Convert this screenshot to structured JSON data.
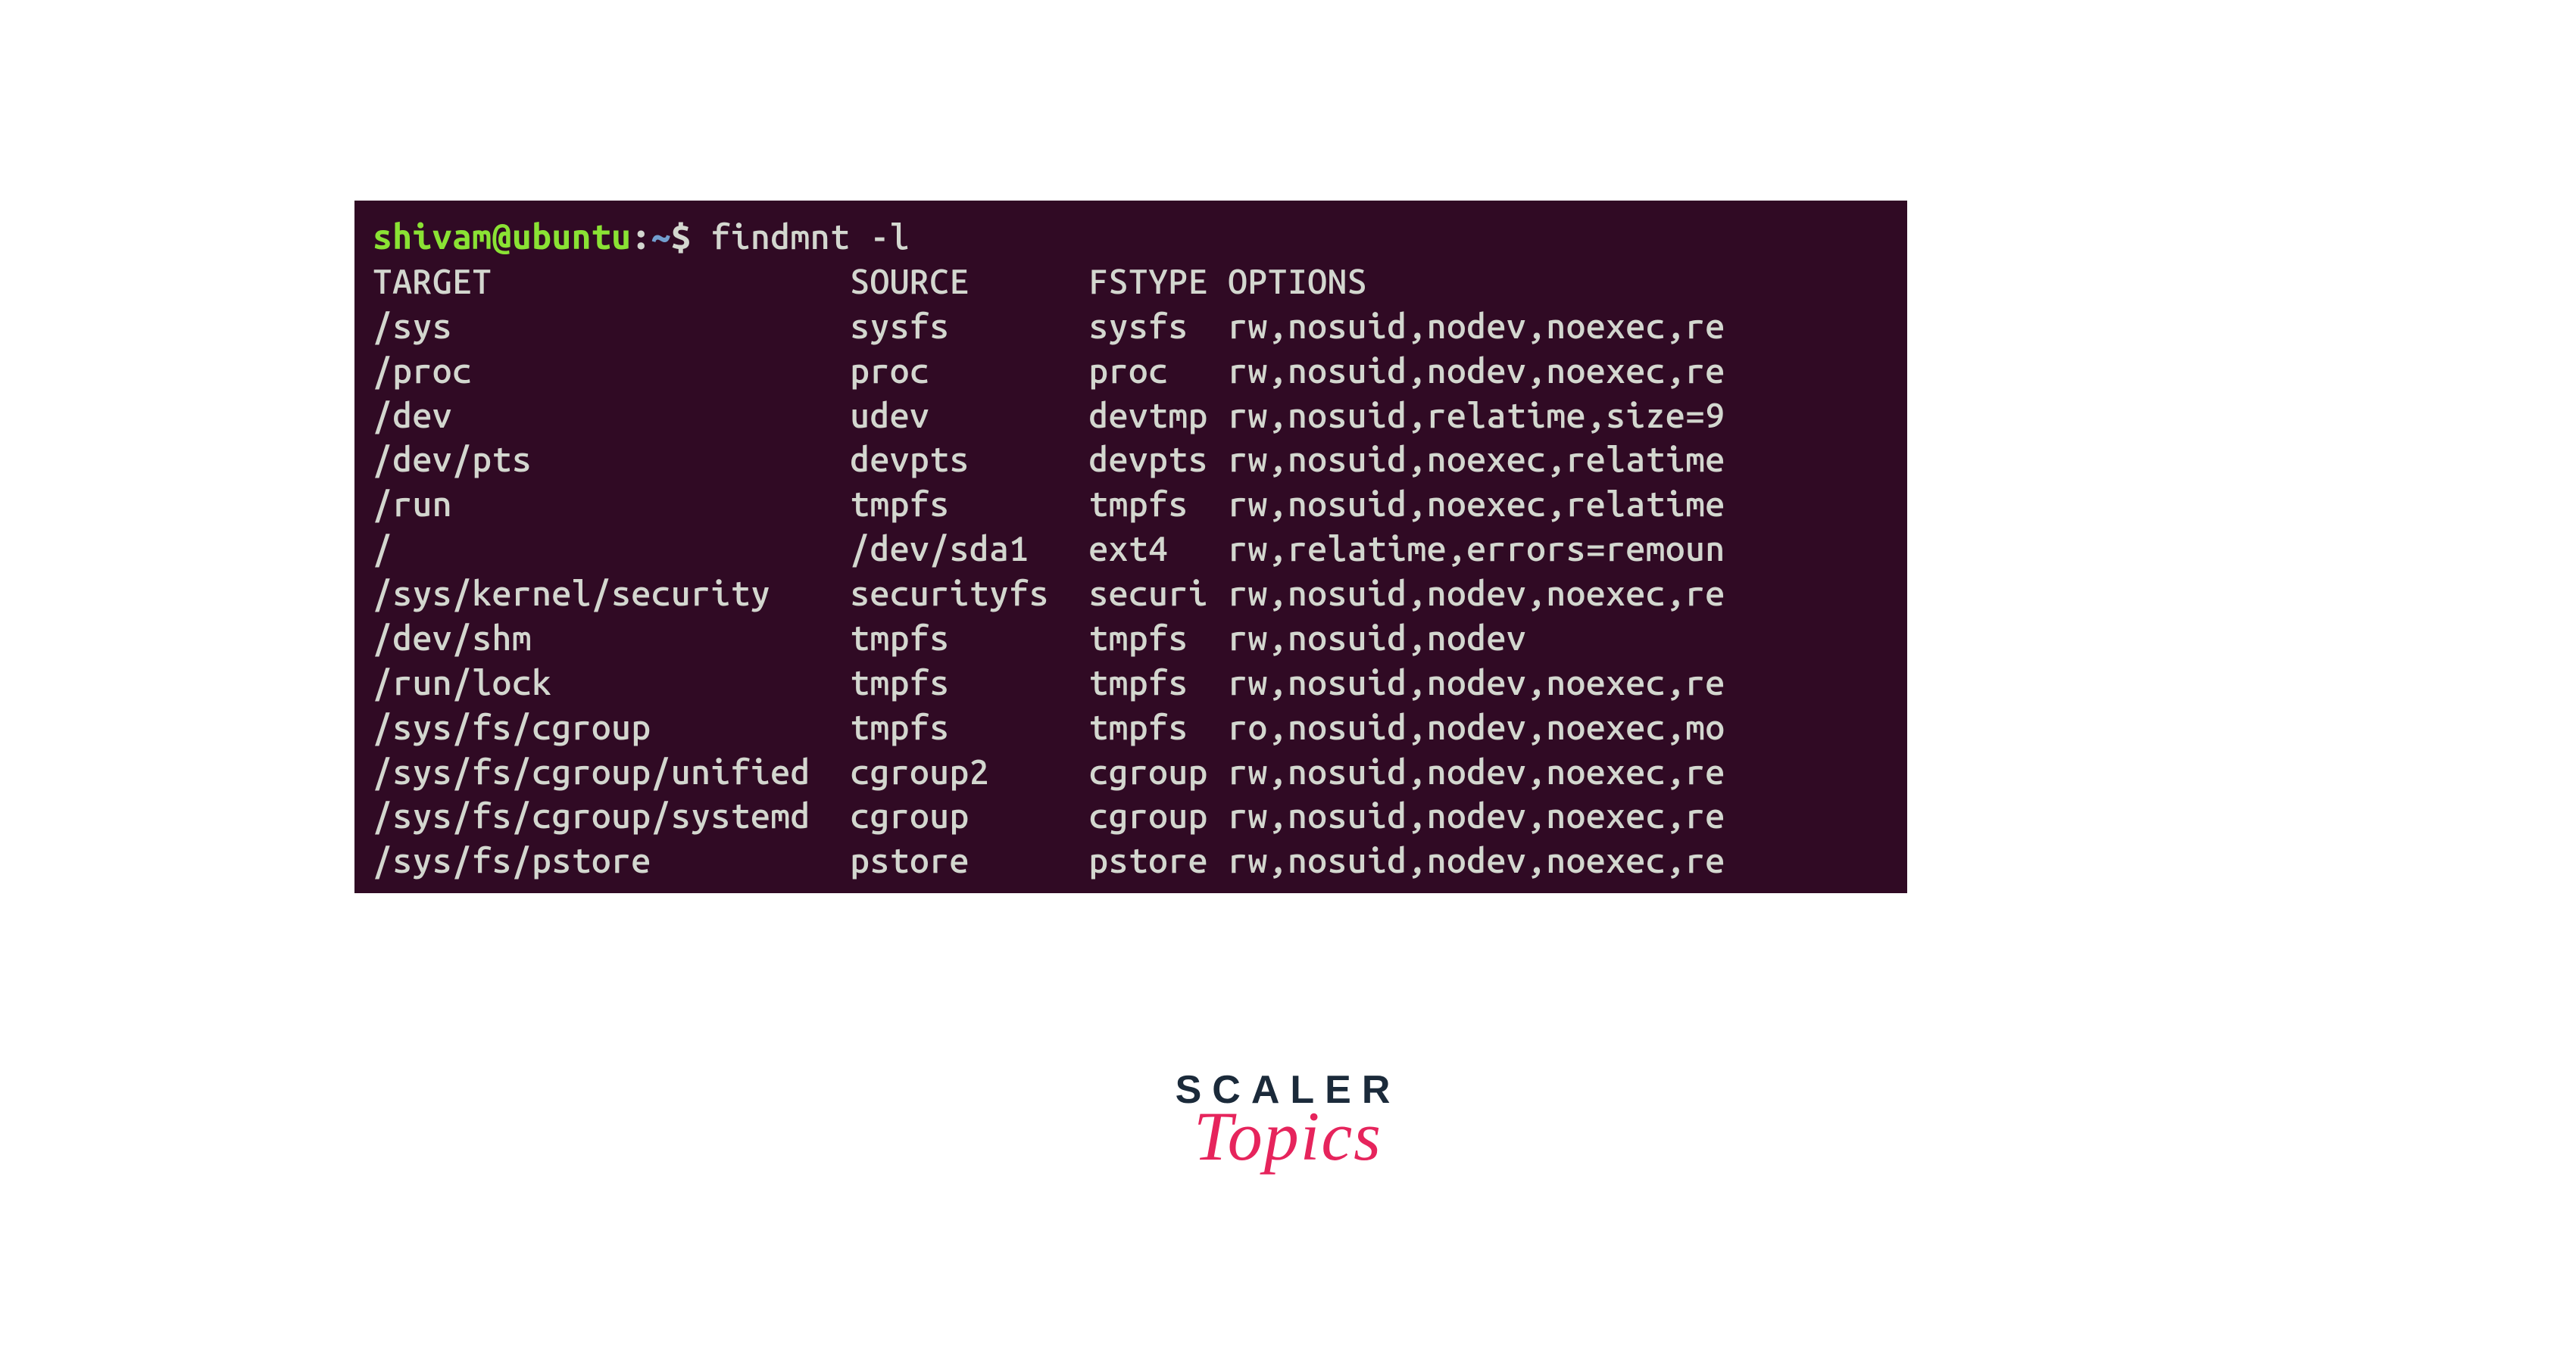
{
  "prompt": {
    "user_host": "shivam@ubuntu",
    "colon": ":",
    "path": "~",
    "dollar": "$",
    "command": "findmnt -l"
  },
  "headers": {
    "target": "TARGET",
    "source": "SOURCE",
    "fstype": "FSTYPE",
    "options": "OPTIONS"
  },
  "rows": [
    {
      "target": "/sys",
      "source": "sysfs",
      "fstype": "sysfs",
      "options": "rw,nosuid,nodev,noexec,re"
    },
    {
      "target": "/proc",
      "source": "proc",
      "fstype": "proc",
      "options": "rw,nosuid,nodev,noexec,re"
    },
    {
      "target": "/dev",
      "source": "udev",
      "fstype": "devtmp",
      "options": "rw,nosuid,relatime,size=9"
    },
    {
      "target": "/dev/pts",
      "source": "devpts",
      "fstype": "devpts",
      "options": "rw,nosuid,noexec,relatime"
    },
    {
      "target": "/run",
      "source": "tmpfs",
      "fstype": "tmpfs",
      "options": "rw,nosuid,noexec,relatime"
    },
    {
      "target": "/",
      "source": "/dev/sda1",
      "fstype": "ext4",
      "options": "rw,relatime,errors=remoun"
    },
    {
      "target": "/sys/kernel/security",
      "source": "securityfs",
      "fstype": "securi",
      "options": "rw,nosuid,nodev,noexec,re"
    },
    {
      "target": "/dev/shm",
      "source": "tmpfs",
      "fstype": "tmpfs",
      "options": "rw,nosuid,nodev"
    },
    {
      "target": "/run/lock",
      "source": "tmpfs",
      "fstype": "tmpfs",
      "options": "rw,nosuid,nodev,noexec,re"
    },
    {
      "target": "/sys/fs/cgroup",
      "source": "tmpfs",
      "fstype": "tmpfs",
      "options": "ro,nosuid,nodev,noexec,mo"
    },
    {
      "target": "/sys/fs/cgroup/unified",
      "source": "cgroup2",
      "fstype": "cgroup",
      "options": "rw,nosuid,nodev,noexec,re"
    },
    {
      "target": "/sys/fs/cgroup/systemd",
      "source": "cgroup",
      "fstype": "cgroup",
      "options": "rw,nosuid,nodev,noexec,re"
    },
    {
      "target": "/sys/fs/pstore",
      "source": "pstore",
      "fstype": "pstore",
      "options": "rw,nosuid,nodev,noexec,re"
    }
  ],
  "columns": {
    "target_width": 23,
    "source_width": 11,
    "fstype_width": 6
  },
  "branding": {
    "scaler": "SCALER",
    "topics": "Topics"
  }
}
